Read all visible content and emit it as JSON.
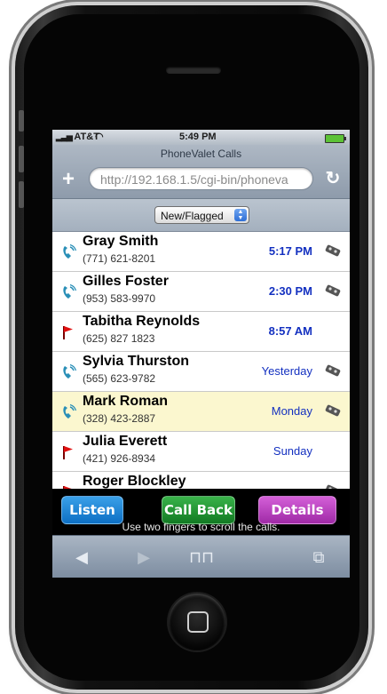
{
  "status_bar": {
    "carrier": "AT&T",
    "time": "5:49 PM"
  },
  "header": {
    "title": "PhoneValet Calls",
    "url": "http://192.168.1.5/cgi-bin/phoneva"
  },
  "filter": {
    "selected": "New/Flagged"
  },
  "calls": [
    {
      "name": "Gray Smith",
      "phone": "(771) 621-8201",
      "time": "5:17 PM",
      "icon": "phone-icon",
      "recorded": true,
      "bold_time": true
    },
    {
      "name": "Gilles Foster",
      "phone": "(953) 583-9970",
      "time": "2:30 PM",
      "icon": "phone-icon",
      "recorded": true,
      "bold_time": true
    },
    {
      "name": "Tabitha Reynolds",
      "phone": "(625) 827 1823",
      "time": "8:57 AM",
      "icon": "flag-icon",
      "recorded": false,
      "bold_time": true
    },
    {
      "name": "Sylvia Thurston",
      "phone": "(565) 623-9782",
      "time": "Yesterday",
      "icon": "phone-icon",
      "recorded": true,
      "bold_time": false
    },
    {
      "name": "Mark Roman",
      "phone": "(328) 423-2887",
      "time": "Monday",
      "icon": "phone-icon",
      "recorded": true,
      "bold_time": false,
      "selected": true
    },
    {
      "name": "Julia Everett",
      "phone": "(421) 926-8934",
      "time": "Sunday",
      "icon": "flag-icon",
      "recorded": false,
      "bold_time": false
    },
    {
      "name": "Roger Blockley",
      "phone": "",
      "time": "",
      "icon": "flag-icon",
      "recorded": true,
      "bold_time": false
    }
  ],
  "actions": {
    "listen": "Listen",
    "call_back": "Call Back",
    "details": "Details"
  },
  "hint": "Use two fingers to scroll the calls.",
  "colors": {
    "listen": "#1f88d8",
    "call_back": "#239a35",
    "details": "#c046c6",
    "time_text": "#1330c0",
    "selected_row": "#fbf7cf"
  }
}
